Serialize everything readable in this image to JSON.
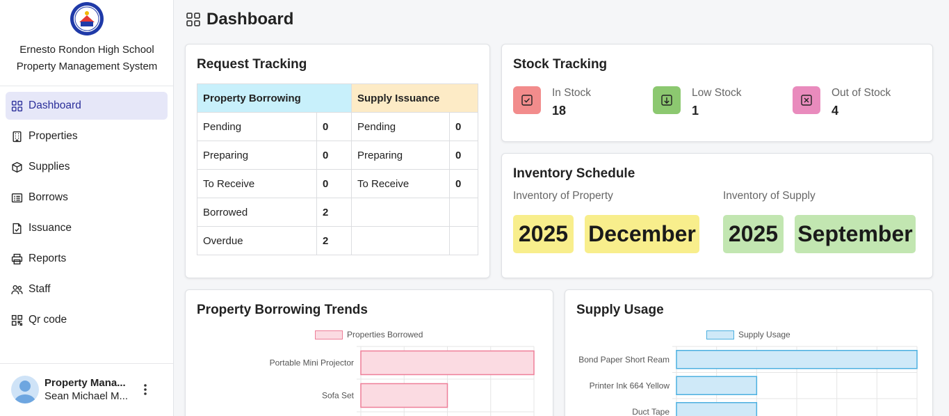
{
  "sidebar": {
    "school_line1": "Ernesto Rondon High School",
    "school_line2": "Property Management System",
    "items": [
      {
        "label": "Dashboard",
        "icon": "grid-icon",
        "active": true
      },
      {
        "label": "Properties",
        "icon": "building-icon"
      },
      {
        "label": "Supplies",
        "icon": "box-icon"
      },
      {
        "label": "Borrows",
        "icon": "list-card-icon"
      },
      {
        "label": "Issuance",
        "icon": "document-check-icon"
      },
      {
        "label": "Reports",
        "icon": "printer-icon"
      },
      {
        "label": "Staff",
        "icon": "people-icon"
      },
      {
        "label": "Qr code",
        "icon": "qr-code-icon"
      }
    ],
    "user": {
      "role": "Property Mana...",
      "name": "Sean Michael M..."
    }
  },
  "header": {
    "title": "Dashboard"
  },
  "request_tracking": {
    "title": "Request Tracking",
    "borrow_header": "Property Borrowing",
    "supply_header": "Supply Issuance",
    "borrow_rows": [
      {
        "label": "Pending",
        "value": "0"
      },
      {
        "label": "Preparing",
        "value": "0"
      },
      {
        "label": "To Receive",
        "value": "0"
      },
      {
        "label": "Borrowed",
        "value": "2"
      },
      {
        "label": "Overdue",
        "value": "2"
      }
    ],
    "supply_rows": [
      {
        "label": "Pending",
        "value": "0"
      },
      {
        "label": "Preparing",
        "value": "0"
      },
      {
        "label": "To Receive",
        "value": "0"
      }
    ]
  },
  "stock_tracking": {
    "title": "Stock Tracking",
    "items": [
      {
        "label": "In Stock",
        "value": "18",
        "color": "#f28c8c",
        "icon": "check-square-icon"
      },
      {
        "label": "Low Stock",
        "value": "1",
        "color": "#8cc870",
        "icon": "down-arrow-square-icon"
      },
      {
        "label": "Out of Stock",
        "value": "4",
        "color": "#e98bbd",
        "icon": "x-square-icon"
      }
    ]
  },
  "inventory_schedule": {
    "title": "Inventory Schedule",
    "property_label": "Inventory of Property",
    "property_year": "2025",
    "property_month": "December",
    "supply_label": "Inventory of Supply",
    "supply_year": "2025",
    "supply_month": "September",
    "property_color": "#f8ee8c",
    "supply_color": "#c2e6b1"
  },
  "borrowing_trends": {
    "title": "Property Borrowing Trends",
    "legend": "Properties Borrowed",
    "bar_color": "#fbdbe2",
    "border_color": "#ee7e98"
  },
  "supply_usage": {
    "title": "Supply Usage",
    "legend": "Supply Usage",
    "bar_color": "#cfe9f8",
    "border_color": "#4cb0e0"
  },
  "chart_data": [
    {
      "type": "bar",
      "orientation": "horizontal",
      "categories": [
        "Portable Mini Projector",
        "Sofa Set"
      ],
      "series": [
        {
          "name": "Properties Borrowed",
          "values": [
            2,
            1
          ]
        }
      ],
      "xlim": [
        0,
        2
      ]
    },
    {
      "type": "bar",
      "orientation": "horizontal",
      "categories": [
        "Bond Paper Short Ream",
        "Printer Ink 664 Yellow",
        "Duct Tape"
      ],
      "series": [
        {
          "name": "Supply Usage",
          "values": [
            3,
            1,
            1
          ]
        }
      ],
      "xlim": [
        0,
        3
      ]
    }
  ]
}
